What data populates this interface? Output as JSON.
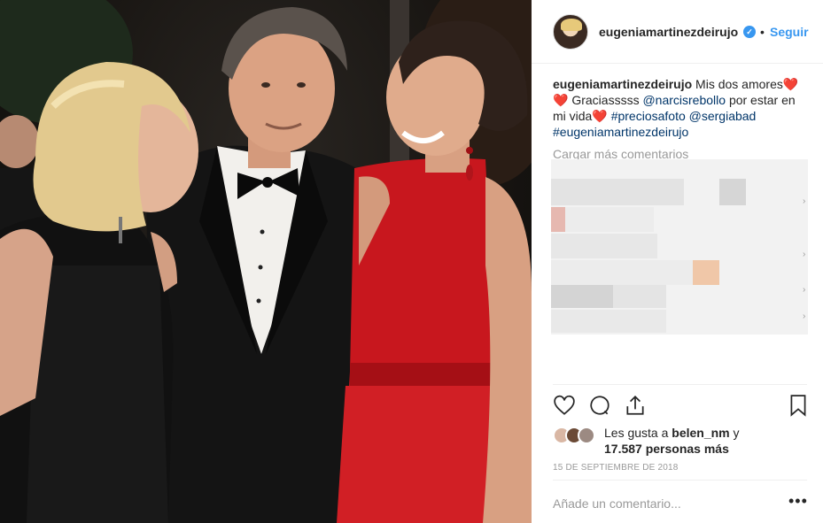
{
  "header": {
    "username": "eugeniamartinezdeirujo",
    "separator": "•",
    "follow_label": "Seguir"
  },
  "caption": {
    "username": "eugeniamartinezdeirujo",
    "text_1": "Mis dos amores",
    "text_2": "Graciasssss",
    "mention_1": "@narcisrebollo",
    "text_3": "por estar en mi vida",
    "hashtag_1": "#preciosafoto",
    "mention_2": "@sergiabad",
    "hashtag_2": "#eugeniamartinezdeirujo",
    "heart": "❤️"
  },
  "comments": {
    "load_more": "Cargar más comentarios"
  },
  "likes": {
    "prefix": "Les gusta a",
    "user": "belen_nm",
    "conj": "y",
    "count": "17.587 personas más"
  },
  "date": "15 DE SEPTIEMBRE DE 2018",
  "comment_box": {
    "placeholder": "Añade un comentario...",
    "more": "•••"
  },
  "colors": {
    "accent": "#3897f0",
    "heart": "#e0245e",
    "muted": "#999999"
  },
  "icons": [
    "verified-badge-icon",
    "heart-icon",
    "comment-icon",
    "share-icon",
    "bookmark-icon",
    "chevron-right-icon",
    "more-options-icon"
  ]
}
